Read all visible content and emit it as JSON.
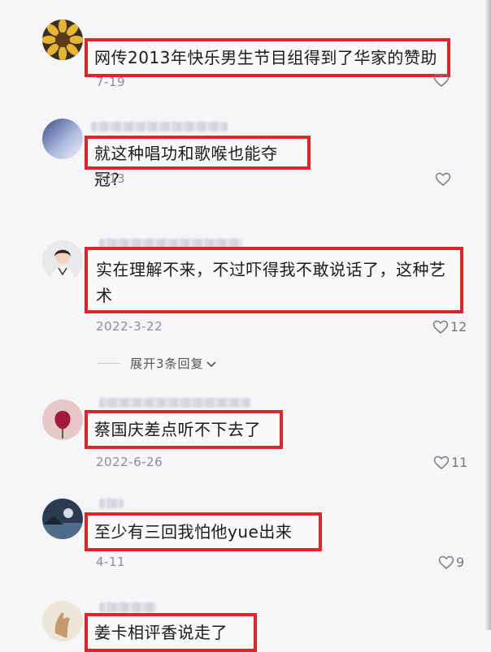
{
  "comments": [
    {
      "text": "网传2013年快乐男生节目组得到了华家的赞助",
      "date": "7-19",
      "likes": ""
    },
    {
      "text": "就这种唱功和歌喉也能夺冠?",
      "date": "7-13",
      "likes": ""
    },
    {
      "text": "实在理解不来，不过吓得我不敢说话了，这种艺术",
      "date": "2022-3-22",
      "likes": "12"
    },
    {
      "text": "蔡国庆差点听不下去了",
      "date": "2022-6-26",
      "likes": "11"
    },
    {
      "text": "至少有三回我怕他yue出来",
      "date": "4-11",
      "likes": "9"
    },
    {
      "text": "姜卡相评香说走了",
      "date": "",
      "likes": ""
    }
  ],
  "expand_replies": "展开3条回复",
  "icons": {
    "like": "heart-outline-icon",
    "expand": "chevron-down-icon"
  },
  "colors": {
    "highlight_border": "#e0242a",
    "background": "#f6f6f8"
  }
}
